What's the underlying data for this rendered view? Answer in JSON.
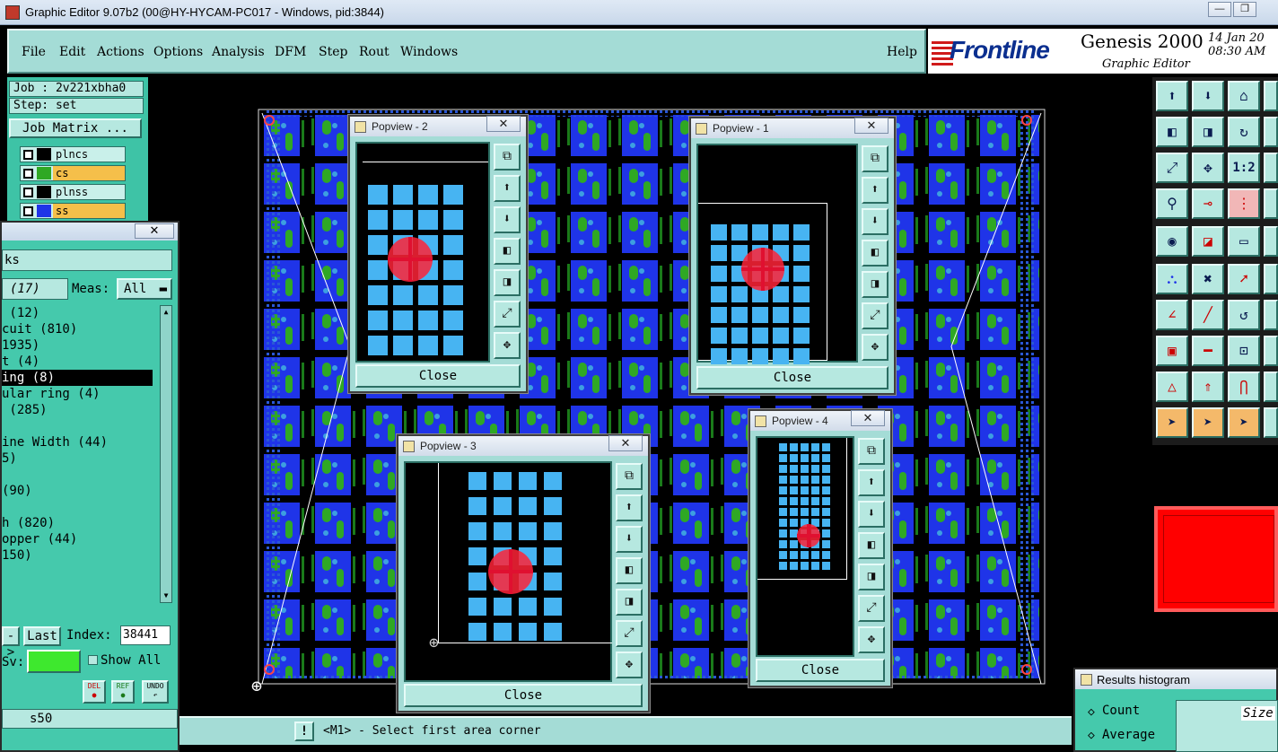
{
  "titlebar": {
    "title": "Graphic Editor 9.07b2 (00@HY-HYCAM-PC017 - Windows, pid:3844)",
    "minimize": "—",
    "restore": "❐"
  },
  "menu": [
    "File",
    "Edit",
    "Actions",
    "Options",
    "Analysis",
    "DFM",
    "Step",
    "Rout",
    "Windows"
  ],
  "help": "Help",
  "brand": {
    "logo": "Frontline",
    "product": "Genesis 2000",
    "subtitle": "Graphic Editor",
    "date": "14 Jan 20",
    "time": "08:30 AM"
  },
  "job": {
    "job_label": "Job : 2v221xbha0",
    "step_label": "Step: set",
    "matrix_button": "Job Matrix ..."
  },
  "layers": [
    {
      "name": "plncs",
      "color": "#000000"
    },
    {
      "name": "cs",
      "color": "#2fa824",
      "highlight": "#f5bf4a"
    },
    {
      "name": "plnss",
      "color": "#000000"
    },
    {
      "name": "ss",
      "color": "#1f34e8",
      "highlight": "#f5bf4a"
    }
  ],
  "checks": {
    "close": "✕",
    "header": "ks",
    "count_field": "(17)",
    "meas_label": "Meas:",
    "meas_value": "All",
    "items": [
      " (12)",
      "cuit (810)",
      "1935)",
      "t (4)",
      "ing (8)",
      "ular ring (4)",
      " (285)",
      "",
      "ine Width (44)",
      "5)",
      "",
      "(90)",
      "",
      "h (820)",
      "opper (44)",
      "150)"
    ],
    "selected_index": 4,
    "next_button": "->",
    "last_button": "Last",
    "index_label": "Index:",
    "index_value": "38441",
    "sv_label": "Sv:",
    "show_all": "Show All",
    "del": "DEL",
    "ref": "REF",
    "undo": "UNDO",
    "bottom_field": "s50"
  },
  "popviews": [
    {
      "title": "Popview - 2",
      "close": "Close"
    },
    {
      "title": "Popview - 1",
      "close": "Close"
    },
    {
      "title": "Popview - 3",
      "close": "Close"
    },
    {
      "title": "Popview - 4",
      "close": "Close"
    }
  ],
  "popview_close_x": "✕",
  "tool_icons": [
    "zoom-fit-icon",
    "zoom-in-icon",
    "zoom-out-icon",
    "pan-left-icon",
    "pan-right-icon",
    "zoom-window-icon",
    "center-icon"
  ],
  "right_tools_labels": [
    "1:2"
  ],
  "status": {
    "bang": "!",
    "prompt": "<M1> - Select first area corner"
  },
  "histogram": {
    "title": "Results histogram",
    "count": "Count",
    "average": "Average",
    "size_label": "Size"
  },
  "colors": {
    "board_blue": "#1f34e8",
    "board_green": "#2fa824",
    "pad_blue": "#47b4f2",
    "marker_red": "#e01030",
    "panel_teal": "#45c9ac",
    "menu_teal": "#a4dcd6"
  }
}
